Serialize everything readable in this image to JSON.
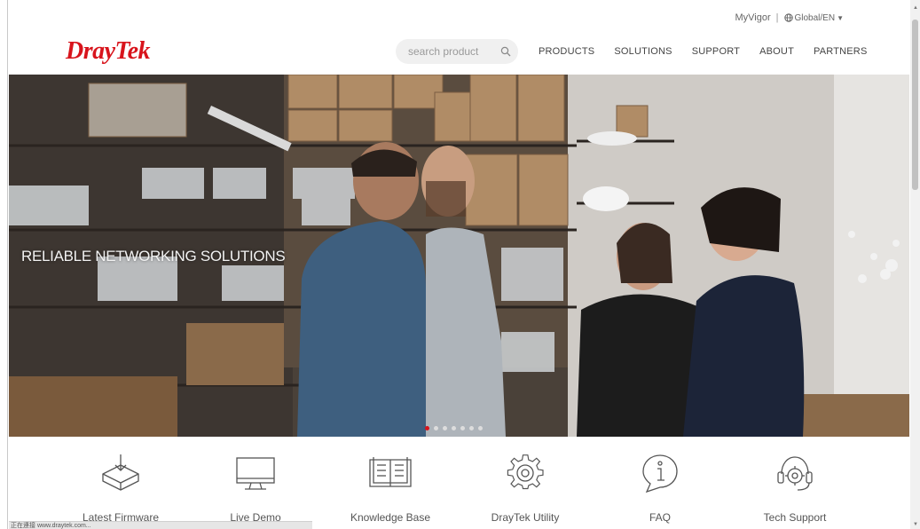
{
  "header": {
    "logo": "DrayTek",
    "myvigor": "MyVigor",
    "separator": "|",
    "language": "Global/EN",
    "search_placeholder": "search product",
    "nav": [
      "PRODUCTS",
      "SOLUTIONS",
      "SUPPORT",
      "ABOUT",
      "PARTNERS"
    ]
  },
  "hero": {
    "title": "RELIABLE NETWORKING SOLUTIONS",
    "slides_count": 7,
    "active_slide": 1
  },
  "features": [
    {
      "label": "Latest Firmware",
      "icon": "firmware-download-icon"
    },
    {
      "label": "Live Demo",
      "icon": "monitor-icon"
    },
    {
      "label": "Knowledge Base",
      "icon": "open-book-icon"
    },
    {
      "label": "DrayTek Utility",
      "icon": "gear-icon"
    },
    {
      "label": "FAQ",
      "icon": "info-bubble-icon"
    },
    {
      "label": "Tech Support",
      "icon": "headset-gear-icon"
    }
  ],
  "statusbar": {
    "text": "正在連接 www.draytek.com..."
  },
  "colors": {
    "brand": "#d8141c",
    "nav_text": "#444444"
  }
}
